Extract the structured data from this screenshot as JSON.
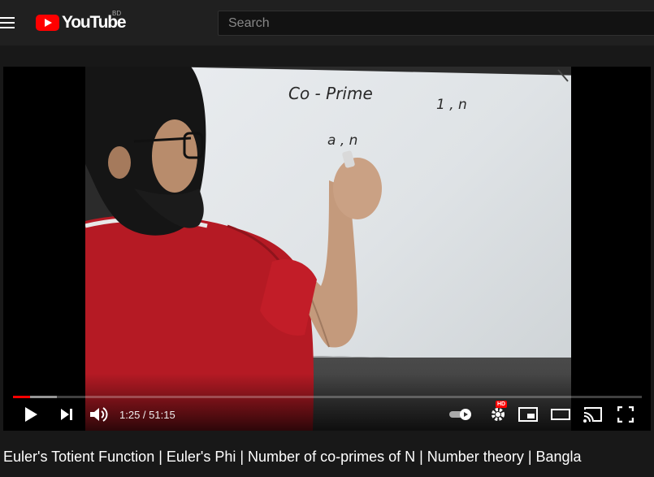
{
  "header": {
    "logo_text": "YouTube",
    "country_code": "BD",
    "search_placeholder": "Search"
  },
  "player": {
    "current_time": "1:25",
    "duration": "51:15",
    "time_separator": " / ",
    "progress_played_fraction": 0.0277,
    "progress_loaded_fraction": 0.07,
    "hd_label": "HD",
    "whiteboard_text": {
      "heading": "Co - Prime",
      "top_right": "1 , n",
      "middle": "a , n"
    }
  },
  "video": {
    "title": "Euler's Totient Function | Euler's Phi | Number of co-primes of N | Number theory | Bangla"
  },
  "colors": {
    "accent": "#ff0000",
    "background": "#181818",
    "topbar": "#202020"
  },
  "icons": [
    "menu-icon",
    "youtube-logo",
    "play-icon",
    "next-icon",
    "volume-icon",
    "autoplay-toggle-icon",
    "settings-icon",
    "miniplayer-icon",
    "theater-icon",
    "cast-icon",
    "fullscreen-icon"
  ]
}
